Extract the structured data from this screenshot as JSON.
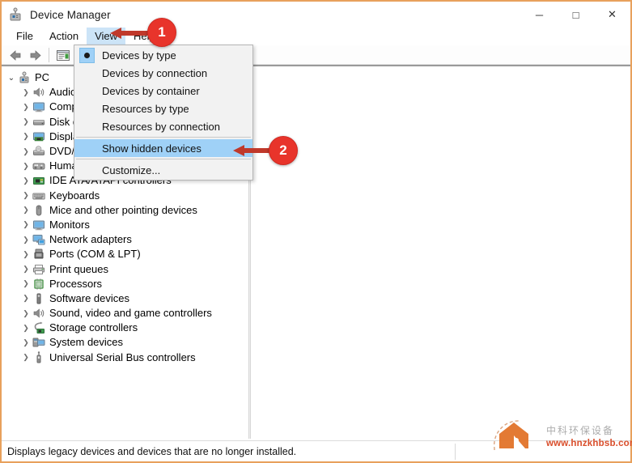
{
  "window": {
    "title": "Device Manager",
    "icon": "device-manager-icon",
    "minimize_label": "─",
    "maximize_label": "□",
    "close_label": "✕",
    "border_color": "#e8a15c"
  },
  "menubar": {
    "items": [
      {
        "label": "File",
        "active": false
      },
      {
        "label": "Action",
        "active": false
      },
      {
        "label": "View",
        "active": true
      },
      {
        "label": "Help",
        "active": false
      }
    ]
  },
  "toolbar": {
    "buttons": [
      {
        "name": "back-button",
        "icon": "left-arrow-icon"
      },
      {
        "name": "forward-button",
        "icon": "right-arrow-icon"
      },
      {
        "name": "properties-button",
        "icon": "properties-window-icon"
      }
    ]
  },
  "view_menu": {
    "items": [
      {
        "label": "Devices by type",
        "radio": true,
        "selected": false,
        "checked": true
      },
      {
        "label": "Devices by connection",
        "radio": false,
        "selected": false,
        "checked": false
      },
      {
        "label": "Devices by container",
        "radio": false,
        "selected": false,
        "checked": false
      },
      {
        "label": "Resources by type",
        "radio": false,
        "selected": false,
        "checked": false
      },
      {
        "label": "Resources by connection",
        "radio": false,
        "selected": false,
        "checked": false
      },
      {
        "label": "Show hidden devices",
        "radio": false,
        "selected": true,
        "checked": false
      },
      {
        "label": "Customize...",
        "radio": false,
        "selected": false,
        "checked": false
      }
    ],
    "highlight_color": "#9fd1f7"
  },
  "tree": {
    "root": {
      "label": "PC",
      "icon": "computer-icon",
      "expanded": true
    },
    "items": [
      {
        "label": "Audio inputs and outputs",
        "icon": "speaker-icon"
      },
      {
        "label": "Computer",
        "icon": "monitor-icon"
      },
      {
        "label": "Disk drives",
        "icon": "disk-drive-icon"
      },
      {
        "label": "Display adapters",
        "icon": "display-adapter-icon"
      },
      {
        "label": "DVD/CD-ROM drives",
        "icon": "dvd-drive-icon"
      },
      {
        "label": "Human Interface Devices",
        "icon": "hid-icon"
      },
      {
        "label": "IDE ATA/ATAPI controllers",
        "icon": "ide-controller-icon"
      },
      {
        "label": "Keyboards",
        "icon": "keyboard-icon"
      },
      {
        "label": "Mice and other pointing devices",
        "icon": "mouse-icon"
      },
      {
        "label": "Monitors",
        "icon": "monitor-icon"
      },
      {
        "label": "Network adapters",
        "icon": "network-adapter-icon"
      },
      {
        "label": "Ports (COM & LPT)",
        "icon": "port-icon"
      },
      {
        "label": "Print queues",
        "icon": "printer-icon"
      },
      {
        "label": "Processors",
        "icon": "processor-icon"
      },
      {
        "label": "Software devices",
        "icon": "software-device-icon"
      },
      {
        "label": "Sound, video and game controllers",
        "icon": "speaker-icon"
      },
      {
        "label": "Storage controllers",
        "icon": "storage-controller-icon"
      },
      {
        "label": "System devices",
        "icon": "system-device-icon"
      },
      {
        "label": "Universal Serial Bus controllers",
        "icon": "usb-icon"
      }
    ],
    "collapsed_glyph": "❯",
    "expanded_glyph": "⌄"
  },
  "statusbar": {
    "text": "Displays legacy devices and devices that are no longer installed."
  },
  "annotations": {
    "accent_color": "#e8342b",
    "markers": [
      {
        "label": "1",
        "target": "view-menu"
      },
      {
        "label": "2",
        "target": "show-hidden-devices-menu-item"
      }
    ]
  },
  "watermark": {
    "url": "www.hnzkhbsb.com",
    "brand": "中科环保设备",
    "logo": "house-logo"
  }
}
